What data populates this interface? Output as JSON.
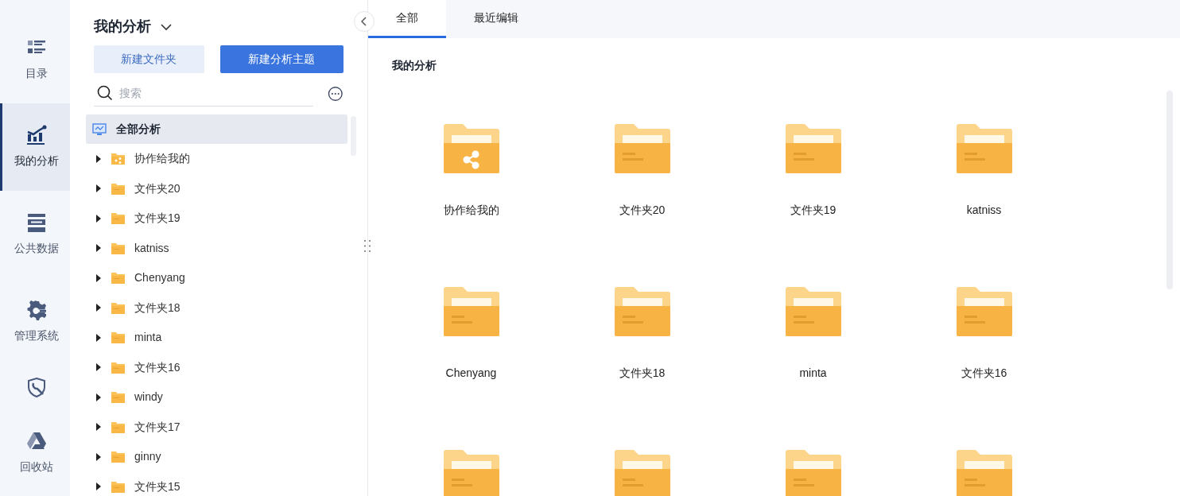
{
  "nav": [
    {
      "label": "目录",
      "selected": false
    },
    {
      "label": "我的分析",
      "selected": true
    },
    {
      "label": "公共数据",
      "selected": false
    },
    {
      "label": "管理系统",
      "selected": false
    },
    {
      "selected": false
    },
    {
      "label": "回收站",
      "selected": false
    }
  ],
  "sidebar": {
    "title": "我的分析",
    "buttons": [
      {
        "label": "新建文件夹",
        "kind": "secondary"
      },
      {
        "label": "新建分析主题",
        "kind": "primary"
      }
    ],
    "search": {
      "placeholder": "搜索"
    },
    "tree": {
      "label": "全部分析",
      "selected": true,
      "children": [
        {
          "label": "协作给我的",
          "kind": "shared",
          "expanded": false
        },
        {
          "label": "文件夹20",
          "kind": "folder",
          "expanded": false
        },
        {
          "label": "文件夹19",
          "kind": "folder",
          "expanded": false
        },
        {
          "label": "katniss",
          "kind": "folder",
          "expanded": false
        },
        {
          "label": "Chenyang",
          "kind": "folder",
          "expanded": false
        },
        {
          "label": "文件夹18",
          "kind": "folder",
          "expanded": false
        },
        {
          "label": "minta",
          "kind": "folder",
          "expanded": false
        },
        {
          "label": "文件夹16",
          "kind": "folder",
          "expanded": false
        },
        {
          "label": "windy",
          "kind": "folder",
          "expanded": false
        },
        {
          "label": "文件夹17",
          "kind": "folder",
          "expanded": false
        },
        {
          "label": "ginny",
          "kind": "folder",
          "expanded": false
        },
        {
          "label": "文件夹15",
          "kind": "folder",
          "expanded": false
        }
      ]
    }
  },
  "tabs": [
    {
      "label": "全部",
      "selected": true
    },
    {
      "label": "最近编辑",
      "selected": false
    }
  ],
  "main": {
    "heading": "我的分析",
    "items": [
      {
        "name": "协作给我的",
        "kind": "shared"
      },
      {
        "name": "文件夹20",
        "kind": "folder"
      },
      {
        "name": "文件夹19",
        "kind": "folder"
      },
      {
        "name": "katniss",
        "kind": "folder"
      },
      {
        "name": "Chenyang",
        "kind": "folder"
      },
      {
        "name": "文件夹18",
        "kind": "folder"
      },
      {
        "name": "minta",
        "kind": "folder"
      },
      {
        "name": "文件夹16",
        "kind": "folder"
      },
      {
        "kind": "folder"
      },
      {
        "kind": "folder"
      },
      {
        "kind": "folder"
      },
      {
        "kind": "folder"
      }
    ]
  }
}
